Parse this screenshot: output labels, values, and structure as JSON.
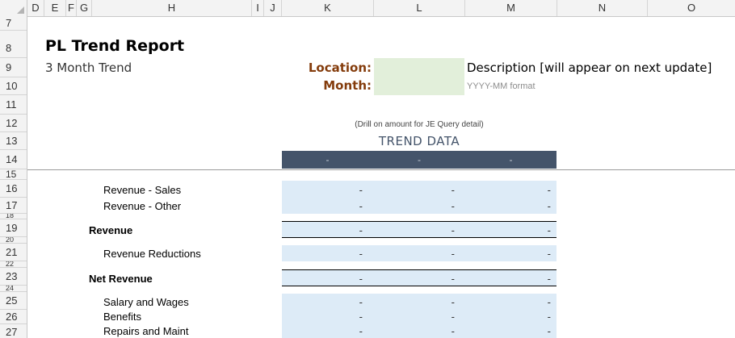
{
  "columns": [
    "D",
    "E",
    "F",
    "G",
    "H",
    "I",
    "J",
    "K",
    "L",
    "M",
    "N",
    "O"
  ],
  "rows": [
    "7",
    "8",
    "9",
    "10",
    "11",
    "12",
    "13",
    "14",
    "15",
    "16",
    "17",
    "18",
    "19",
    "20",
    "21",
    "22",
    "23",
    "24",
    "25",
    "26",
    "27"
  ],
  "report": {
    "title": "PL Trend Report",
    "subtitle": "3 Month Trend",
    "location_label": "Location:",
    "month_label": "Month:",
    "location_value": "",
    "month_value": "",
    "description": "Description [will appear on next update]",
    "month_format_hint": "YYYY-MM format",
    "drill_note": "(Drill on amount for JE Query detail)",
    "trend_title": "TREND DATA",
    "trend_headers": [
      "-",
      "-",
      "-"
    ]
  },
  "lines": [
    {
      "label": "Revenue - Sales",
      "values": [
        "-",
        "-",
        "-"
      ]
    },
    {
      "label": "Revenue - Other",
      "values": [
        "-",
        "-",
        "-"
      ]
    },
    {
      "label": "Revenue",
      "values": [
        "-",
        "-",
        "-"
      ]
    },
    {
      "label": "Revenue Reductions",
      "values": [
        "-",
        "-",
        "-"
      ]
    },
    {
      "label": "Net Revenue",
      "values": [
        "-",
        "-",
        "-"
      ]
    },
    {
      "label": "Salary and Wages",
      "values": [
        "-",
        "-",
        "-"
      ]
    },
    {
      "label": "Benefits",
      "values": [
        "-",
        "-",
        "-"
      ]
    },
    {
      "label": "Repairs and Maint",
      "values": [
        "-",
        "-",
        "-"
      ]
    }
  ],
  "colors": {
    "title_orange": "#843c0c",
    "input_green": "#e2efda",
    "trend_navy": "#44546a",
    "data_blue": "#ddebf7"
  }
}
